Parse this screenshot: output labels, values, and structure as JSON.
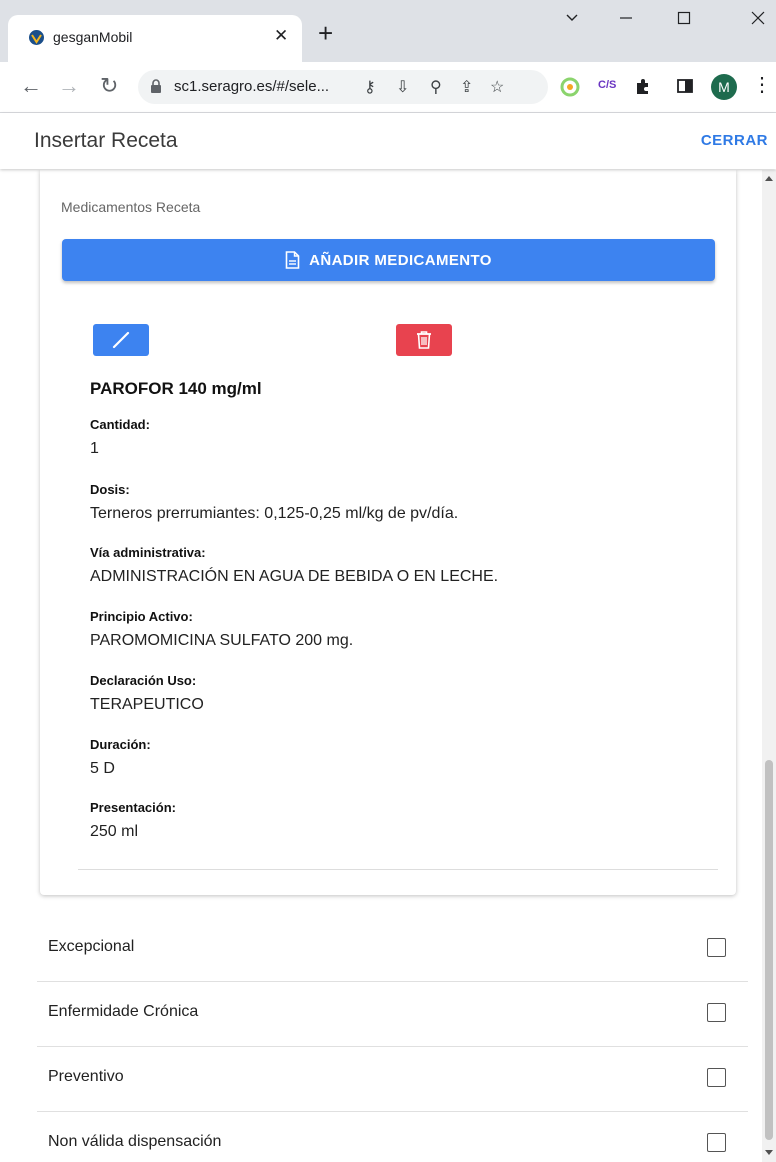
{
  "browser": {
    "tab_title": "gesganMobil",
    "url": "sc1.seragro.es/#/sele...",
    "extension_label": "C/S",
    "profile_initial": "M"
  },
  "header": {
    "title": "Insertar Receta",
    "close_label": "CERRAR"
  },
  "card": {
    "title": "Medicamentos Receta",
    "add_button_label": "AÑADIR MEDICAMENTO",
    "medication": {
      "name": "PAROFOR 140 mg/ml",
      "fields": [
        {
          "label": "Cantidad:",
          "value": "1"
        },
        {
          "label": "Dosis:",
          "value": "Terneros prerrumiantes: 0,125-0,25 ml/kg de pv/día."
        },
        {
          "label": "Vía administrativa:",
          "value": "ADMINISTRACIÓN EN AGUA DE BEBIDA O EN LECHE."
        },
        {
          "label": "Principio Activo:",
          "value": "PAROMOMICINA SULFATO 200 mg."
        },
        {
          "label": "Declaración Uso:",
          "value": "TERAPEUTICO"
        },
        {
          "label": "Duración:",
          "value": "5 D"
        },
        {
          "label": "Presentación:",
          "value": "250 ml"
        }
      ]
    }
  },
  "options": [
    {
      "label": "Excepcional",
      "checked": false
    },
    {
      "label": "Enfermidade Crónica",
      "checked": false
    },
    {
      "label": "Preventivo",
      "checked": false
    },
    {
      "label": "Non válida dispensación",
      "checked": false
    }
  ],
  "colors": {
    "primary": "#3d83f0",
    "danger": "#e8434f",
    "link": "#2f7ae5"
  }
}
